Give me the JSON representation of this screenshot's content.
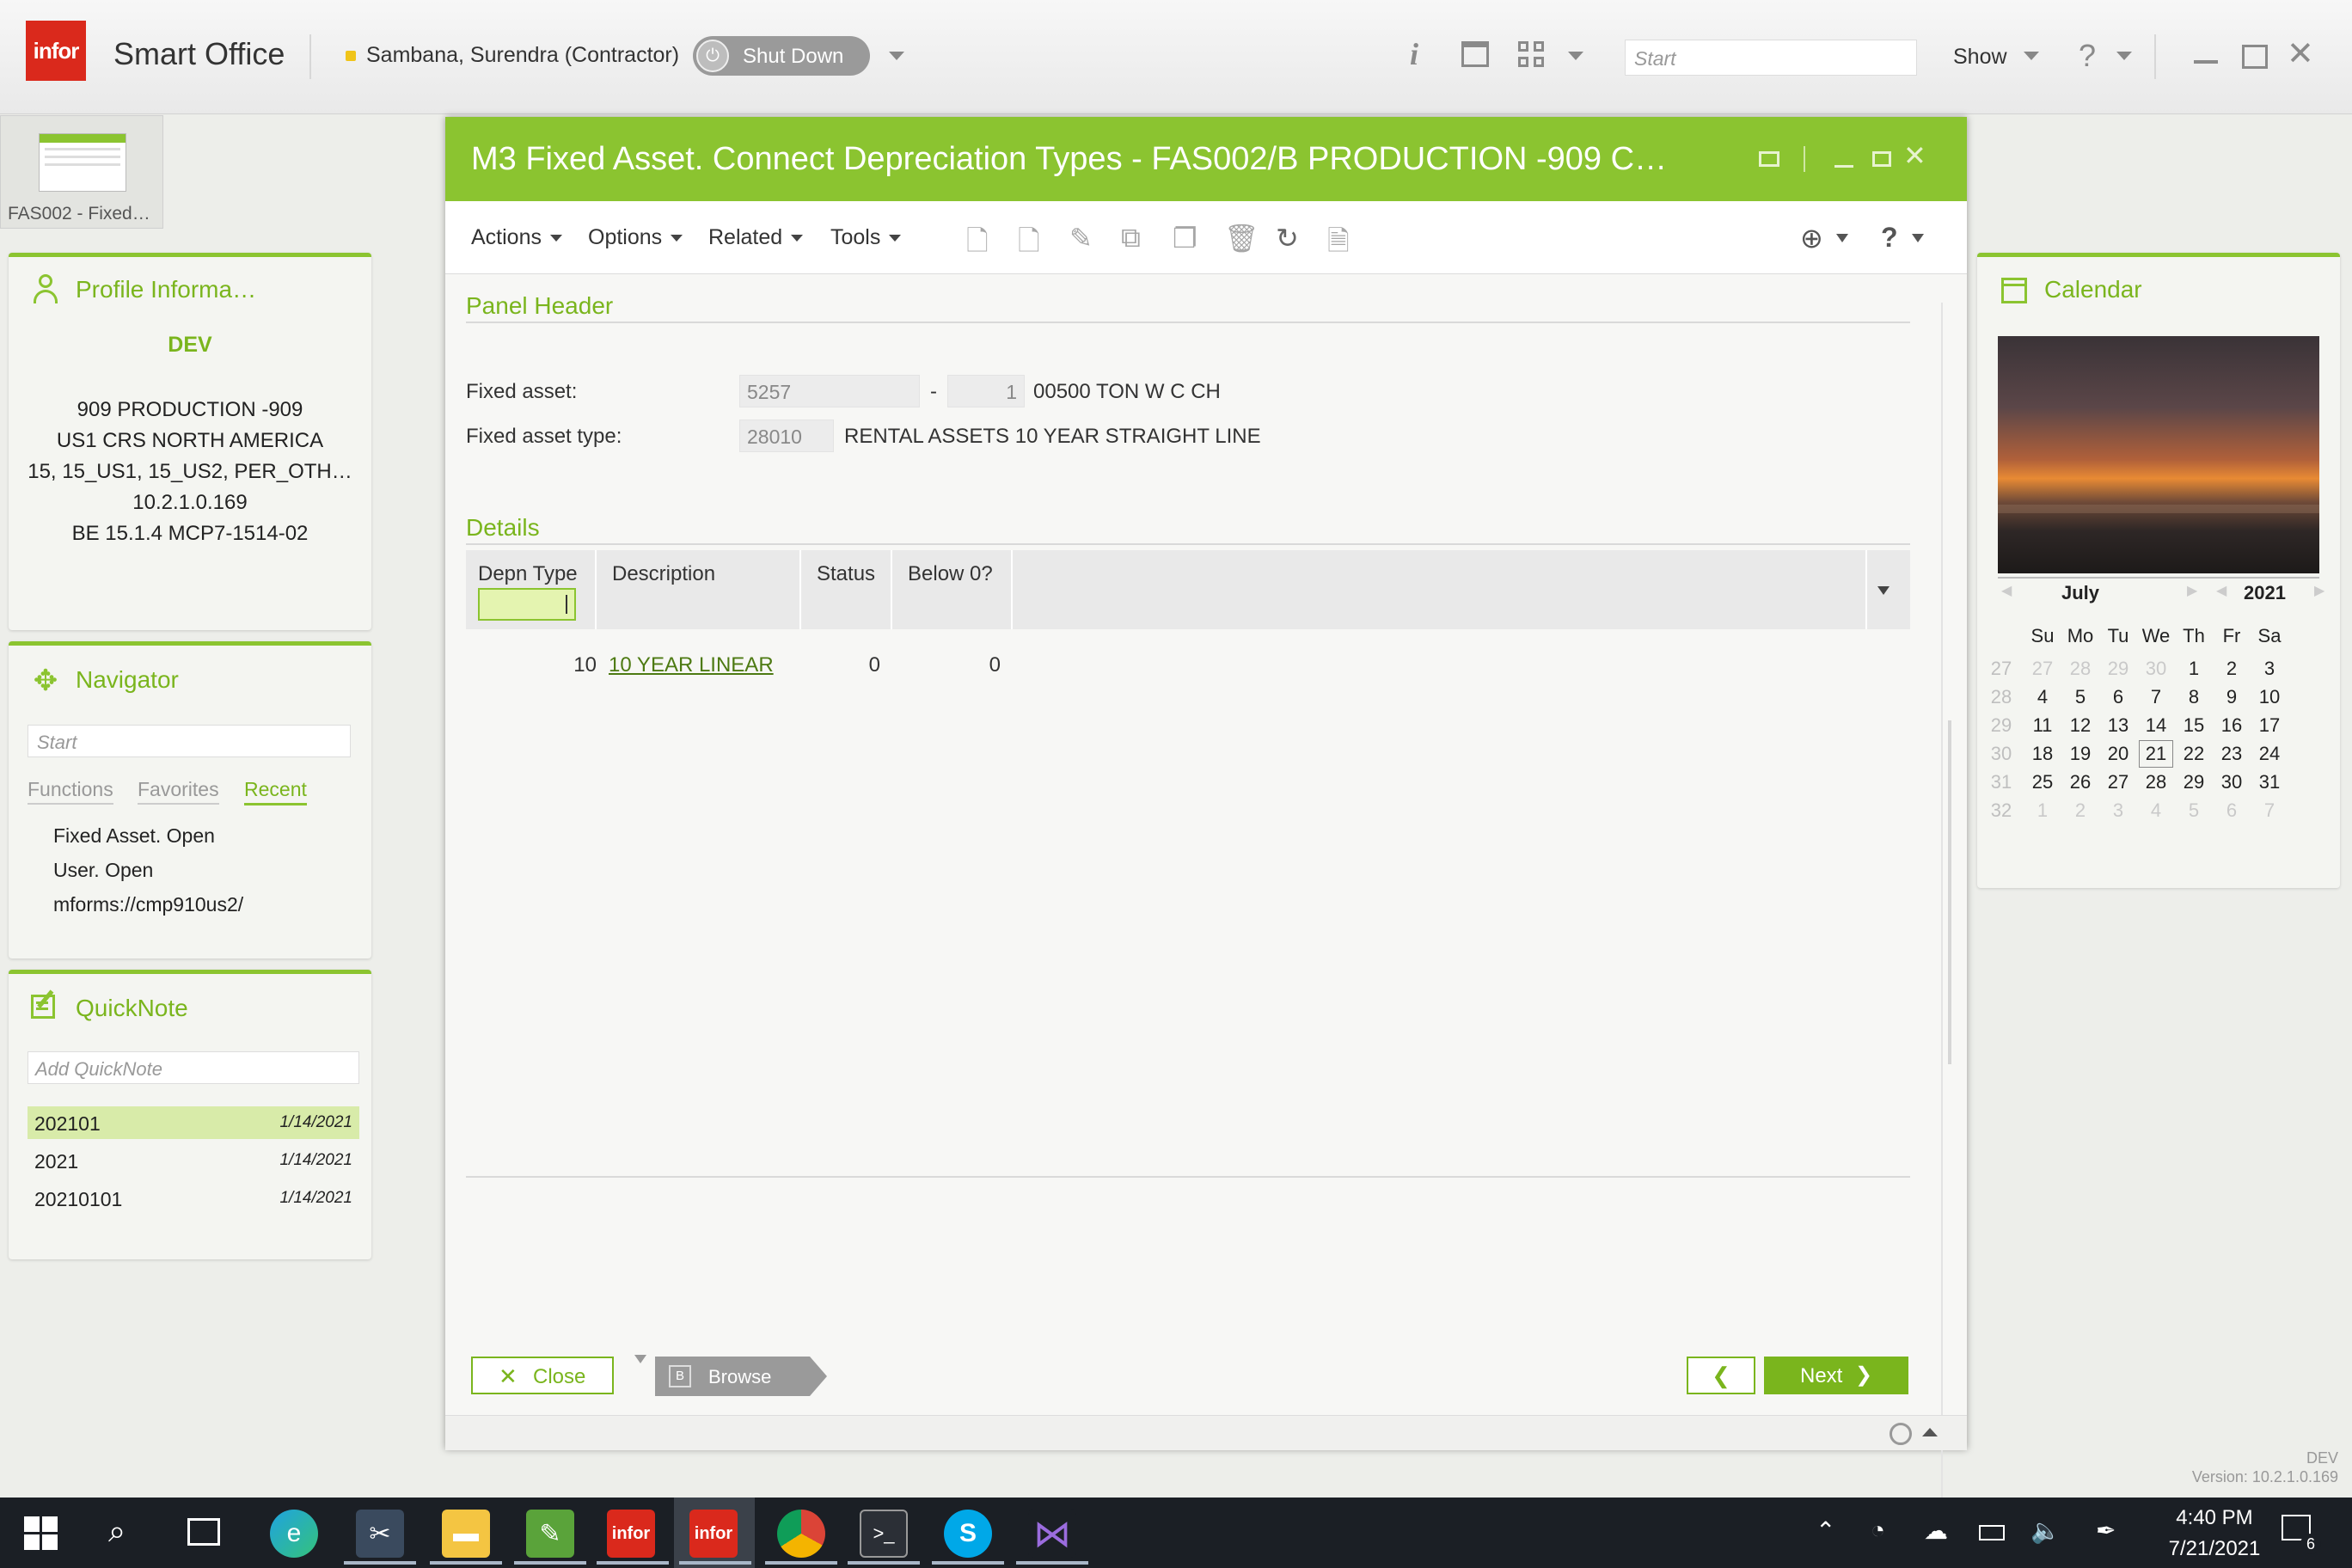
{
  "topbar": {
    "logo": "infor",
    "app_name": "Smart Office",
    "user": "Sambana, Surendra (Contractor)",
    "shutdown_label": "Shut Down",
    "search_placeholder": "Start",
    "show_label": "Show"
  },
  "thumb_tab": {
    "label": "FAS002 - Fixed…"
  },
  "profile": {
    "title": "Profile Informa…",
    "env": "DEV",
    "lines": [
      "909 PRODUCTION -909",
      "US1 CRS NORTH AMERICA",
      "15, 15_US1, 15_US2, PER_OTH…",
      "10.2.1.0.169",
      "BE 15.1.4 MCP7-1514-02"
    ]
  },
  "navigator": {
    "title": "Navigator",
    "search_placeholder": "Start",
    "tabs": [
      "Functions",
      "Favorites",
      "Recent"
    ],
    "items": [
      "Fixed Asset. Open",
      "User. Open",
      "mforms://cmp910us2/"
    ]
  },
  "quicknote": {
    "title": "QuickNote",
    "placeholder": "Add QuickNote",
    "notes": [
      {
        "name": "202101",
        "date": "1/14/2021"
      },
      {
        "name": "2021",
        "date": "1/14/2021"
      },
      {
        "name": "20210101",
        "date": "1/14/2021"
      }
    ]
  },
  "window": {
    "title": "M3 Fixed Asset. Connect Depreciation Types - FAS002/B   PRODUCTION -909 C…",
    "menus": [
      "Actions",
      "Options",
      "Related",
      "Tools"
    ],
    "panel_header": "Panel Header",
    "fixed_asset_label": "Fixed asset:",
    "fixed_asset_value": "5257",
    "fixed_asset_dash": "-",
    "fixed_asset_sub": "1",
    "fixed_asset_desc": "00500 TON W C CH",
    "asset_type_label": "Fixed asset type:",
    "asset_type_value": "28010",
    "asset_type_desc": "RENTAL ASSETS 10 YEAR STRAIGHT LINE",
    "details_title": "Details",
    "columns": [
      "Depn Type",
      "Description",
      "Status",
      "Below 0?"
    ],
    "rows": [
      {
        "depn_type": "10",
        "description": "10 YEAR LINEAR",
        "status": "0",
        "below_zero": "0"
      }
    ],
    "close_label": "Close",
    "browse_key": "B",
    "browse_label": "Browse",
    "next_label": "Next"
  },
  "calendar": {
    "title": "Calendar",
    "month": "July",
    "year": "2021",
    "weekdays": [
      "Su",
      "Mo",
      "Tu",
      "We",
      "Th",
      "Fr",
      "Sa"
    ],
    "weeks": [
      {
        "wk": "27",
        "days": [
          "27",
          "28",
          "29",
          "30",
          "1",
          "2",
          "3"
        ]
      },
      {
        "wk": "28",
        "days": [
          "4",
          "5",
          "6",
          "7",
          "8",
          "9",
          "10"
        ]
      },
      {
        "wk": "29",
        "days": [
          "11",
          "12",
          "13",
          "14",
          "15",
          "16",
          "17"
        ]
      },
      {
        "wk": "30",
        "days": [
          "18",
          "19",
          "20",
          "21",
          "22",
          "23",
          "24"
        ]
      },
      {
        "wk": "31",
        "days": [
          "25",
          "26",
          "27",
          "28",
          "29",
          "30",
          "31"
        ]
      },
      {
        "wk": "32",
        "days": [
          "1",
          "2",
          "3",
          "4",
          "5",
          "6",
          "7"
        ]
      }
    ],
    "today": "21"
  },
  "footer": {
    "env": "DEV",
    "version": "Version: 10.2.1.0.169"
  },
  "taskbar": {
    "time": "4:40 PM",
    "date": "7/21/2021",
    "notifications": "6",
    "infor_label": "infor"
  },
  "colors": {
    "accent": "#8bc430",
    "accent_dark": "#7ab51d",
    "logo_red": "#da291c"
  }
}
